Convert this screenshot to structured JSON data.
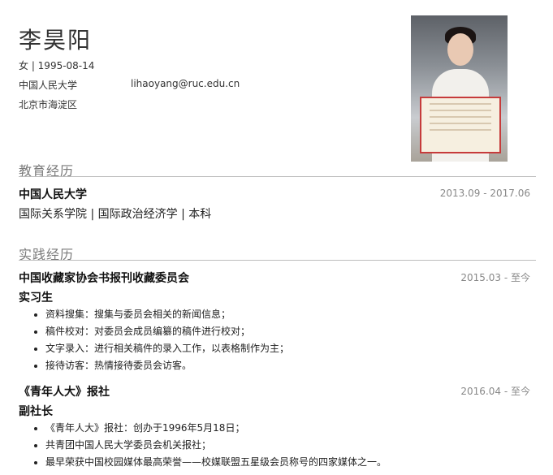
{
  "profile": {
    "name": "李昊阳",
    "gender_birth": "女 | 1995-08-14",
    "school": "中国人民大学",
    "email": "lihaoyang@ruc.edu.cn",
    "location": "北京市海淀区"
  },
  "education": {
    "section_title": "教育经历",
    "school": "中国人民大学",
    "date": "2013.09 - 2017.06",
    "detail": "国际关系学院 | 国际政治经济学 | 本科"
  },
  "practice": {
    "section_title": "实践经历",
    "items": [
      {
        "org": "中国收藏家协会书报刊收藏委员会",
        "date": "2015.03 - 至今",
        "role": "实习生",
        "bullets": [
          "资料搜集：搜集与委员会相关的新闻信息；",
          "稿件校对：对委员会成员编纂的稿件进行校对；",
          "文字录入：进行相关稿件的录入工作，以表格制作为主；",
          "接待访客：热情接待委员会访客。"
        ]
      },
      {
        "org": "《青年人大》报社",
        "date": "2016.04 - 至今",
        "role": "副社长",
        "bullets": [
          "《青年人大》报社：创办于1996年5月18日；",
          "共青团中国人民大学委员会机关报社；",
          "最早荣获中国校园媒体最高荣誉——校媒联盟五星级会员称号的四家媒体之一。"
        ]
      }
    ]
  }
}
